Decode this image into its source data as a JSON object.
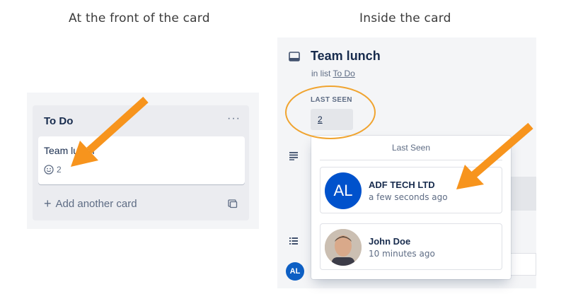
{
  "captions": {
    "front": "At the front of the card",
    "inside": "Inside the card"
  },
  "front": {
    "list_title": "To Do",
    "list_menu": "···",
    "card_title": "Team lunch",
    "badge_icon": "smile-icon",
    "badge_count": "2",
    "add_card_plus": "+",
    "add_card_label": "Add another card"
  },
  "inside": {
    "card_title": "Team lunch",
    "in_list_prefix": "in list",
    "list_name": "To Do",
    "last_seen_label": "LAST SEEN",
    "last_seen_value": "2",
    "member_initials": "AL"
  },
  "popover": {
    "title": "Last Seen",
    "close": "×",
    "viewers": [
      {
        "initials": "AL",
        "name": "ADF TECH LTD",
        "time": "a few seconds ago"
      },
      {
        "initials": "",
        "name": "John Doe",
        "time": "10 minutes ago"
      }
    ]
  },
  "colors": {
    "annotation_arrow": "#f7941d",
    "annotation_ellipse": "#f0a430",
    "avatar_blue": "#0052cc"
  }
}
